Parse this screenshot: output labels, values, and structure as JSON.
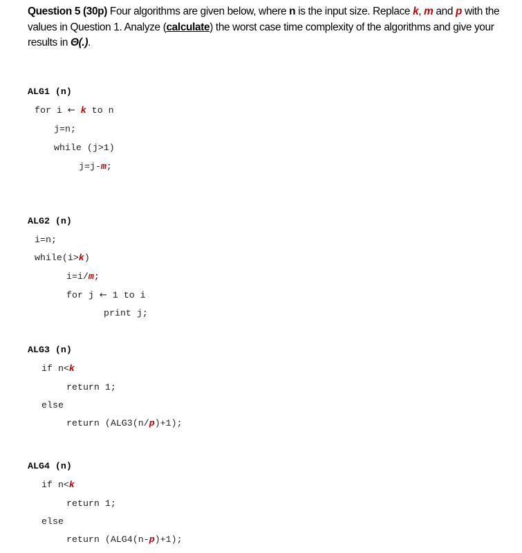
{
  "question": {
    "heading": "Question 5 (30p)",
    "text_1": " Four algorithms are given below, where ",
    "n": "n",
    "text_2": " is the input size. Replace ",
    "k": "k",
    "comma": ", ",
    "m": "m",
    "and": " and ",
    "p": "p",
    "text_3": " with the values in Question 1. Analyze (",
    "calculate": "calculate",
    "text_4": ") the worst case time complexity of the algorithms and give your results in ",
    "theta": "Θ(.)",
    "period": "."
  },
  "algorithms": {
    "alg1": {
      "title": "ALG1 (n)",
      "l1a": "for i ",
      "arrow": "🡐",
      "l1k": "k",
      "l1b": " to n",
      "l2": "j=n;",
      "l3": "while (j>1)",
      "l4a": "j=j-",
      "l4m": "m",
      "l4b": ";"
    },
    "alg2": {
      "title": "ALG2 (n)",
      "l1": "i=n;",
      "l2a": "while(i>",
      "l2k": "k",
      "l2b": ")",
      "l3a": "i=i/",
      "l3m": "m",
      "l3b": ";",
      "l4a": "for j ",
      "arrow": "🡐",
      "l4b": " 1 to i",
      "l5": "print j;"
    },
    "alg3": {
      "title": "ALG3 (n)",
      "l1a": "if n<",
      "l1k": "k",
      "l2": "return 1;",
      "l3": "else",
      "l4a": "return (ALG3(n/",
      "l4p": "p",
      "l4b": ")+1);"
    },
    "alg4": {
      "title": "ALG4 (n)",
      "l1a": "if n<",
      "l1k": "k",
      "l2": "return 1;",
      "l3": "else",
      "l4a": "return (ALG4(n-",
      "l4p": "p",
      "l4b": ")+1);"
    }
  }
}
